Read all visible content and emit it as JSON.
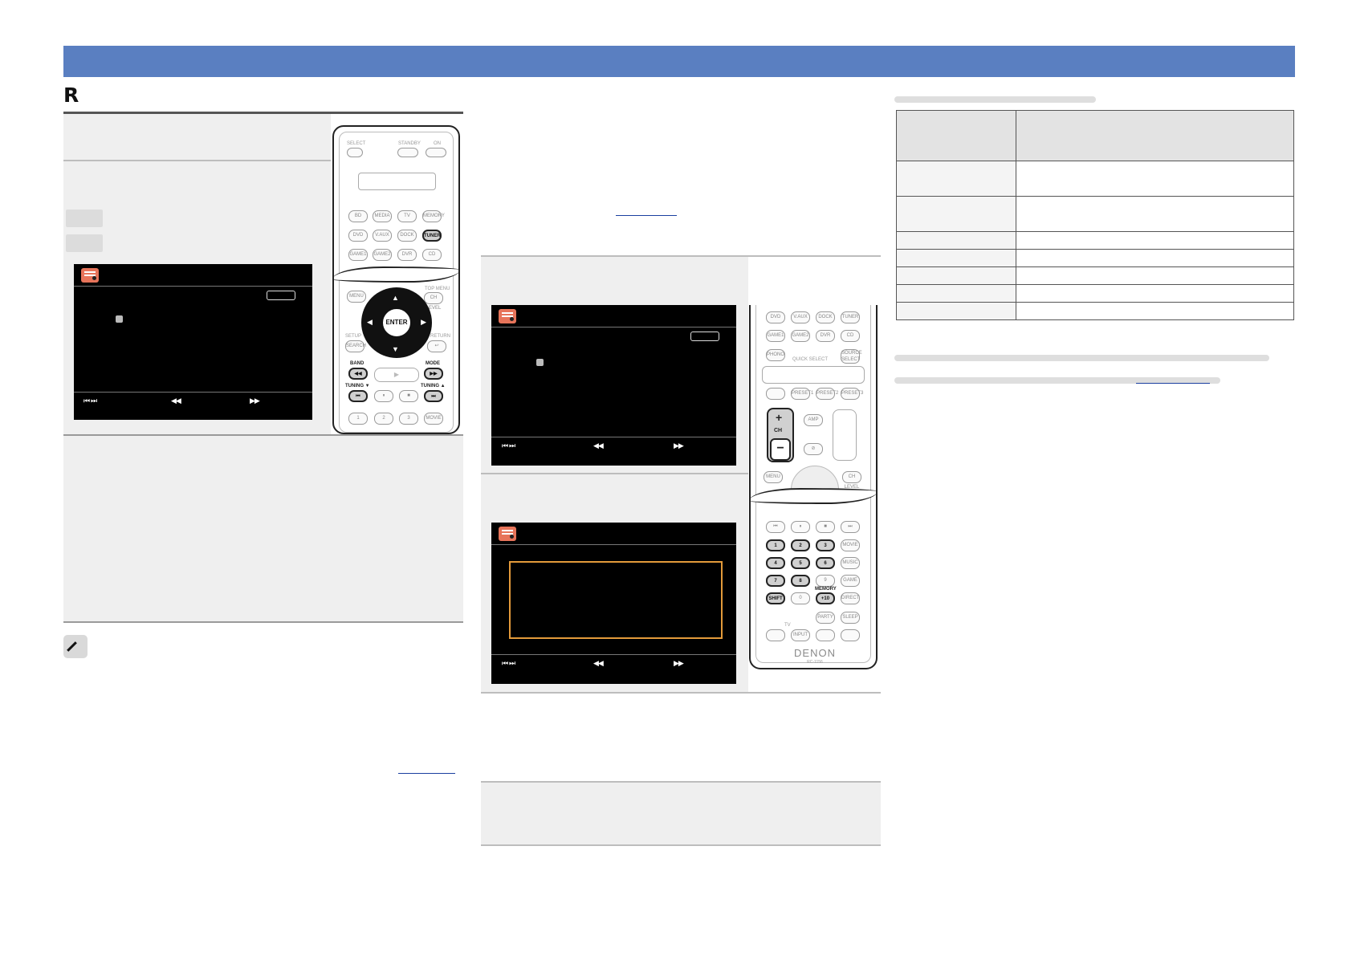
{
  "section": {
    "heading": "R"
  },
  "remote": {
    "denon_logo": "DENON",
    "model": "RC-1156",
    "enter_label": "ENTER",
    "band_label": "BAND",
    "mode_label": "MODE",
    "tuning_down_label": "TUNING ▼",
    "tuning_up_label": "TUNING ▲",
    "ch_label": "CH",
    "memory_label": "MEMORY",
    "shift_label": "SHIFT",
    "plus10_label": "+10",
    "tuner_label": "TUNER",
    "amp_label": "AMP",
    "select_label": "SELECT",
    "standby_label": "STANDBY",
    "on_label": "ON",
    "quick_select_label": "QUICK SELECT",
    "menu_label": "MENU",
    "ch_level_label": "CH LEVEL",
    "search_label": "SEARCH",
    "top_menu_label": "TOP MENU",
    "setup_label": "SETUP",
    "return_label": "RETURN",
    "source_row1": [
      "BD",
      "MEDIA",
      "TV",
      "MEMORY"
    ],
    "source_row2": [
      "DVD",
      "V.AUX",
      "DOCK",
      "TUNER"
    ],
    "source_row3": [
      "GAME1",
      "GAME2",
      "DVR",
      "CD"
    ],
    "source_row2b": [
      "DVD",
      "V.AUX",
      "DOCK",
      "TUNER"
    ],
    "source_row3b": [
      "GAME1",
      "GAME2",
      "DVR",
      "CD"
    ],
    "phono_label": "PHONO",
    "source_select_label": "SOURCE SELECT",
    "preset_labels": [
      "PRESET1",
      "PRESET2",
      "PRESET3"
    ],
    "num_row1": [
      "1",
      "2",
      "3",
      "MOVIE"
    ],
    "num_row2": [
      "4",
      "5",
      "6",
      "MUSIC"
    ],
    "num_row3": [
      "7",
      "8",
      "9",
      "GAME"
    ],
    "num_row4": [
      "SHIFT",
      "0",
      "+10",
      "DIRECT"
    ],
    "party_label": "PARTY",
    "sleep_label": "SLEEP",
    "input_label": "INPUT",
    "tv_label": "TV",
    "top_nums": [
      "1",
      "2",
      "3",
      "MOVIE"
    ],
    "tuner_row_labels": [
      "DVD",
      "V.AUX",
      "DOCK",
      "TUNER"
    ]
  }
}
